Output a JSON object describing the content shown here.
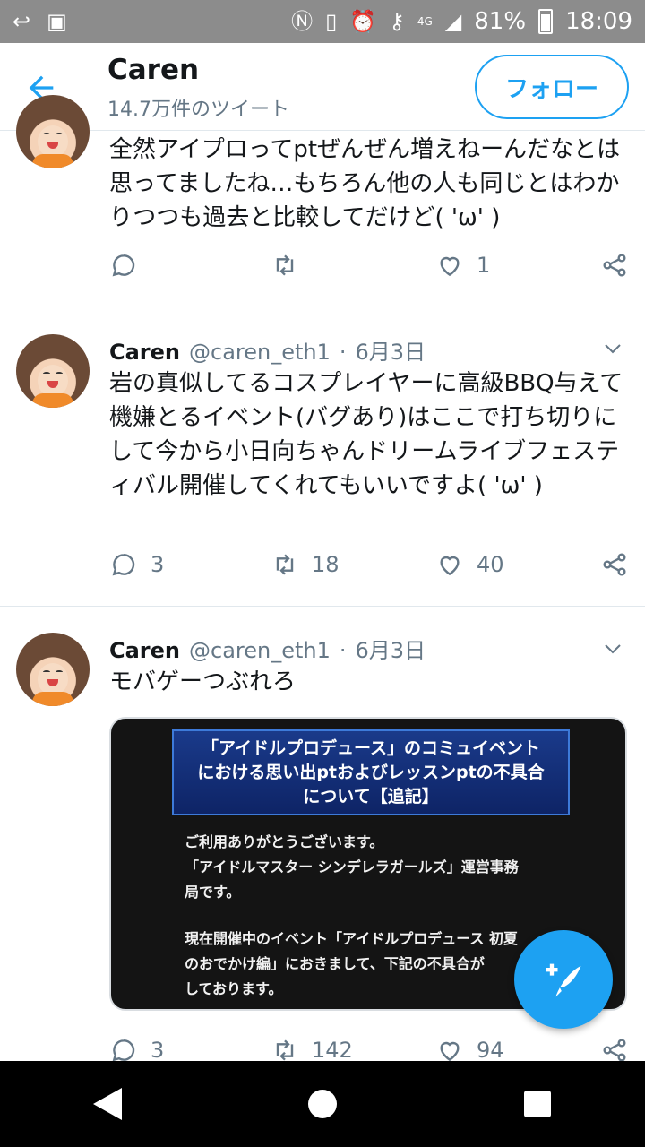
{
  "status_bar": {
    "network": "4G",
    "battery": "81%",
    "time": "18:09"
  },
  "header": {
    "name": "Caren",
    "tweet_count": "14.7万件のツイート",
    "follow_label": "フォロー"
  },
  "tweets": [
    {
      "text": "全然アイプロってptぜんぜん増えねーんだなとは思ってましたね…もちろん他の人も同じとはわかりつつも過去と比較してだけど( 'ω' )",
      "replies": "",
      "retweets": "",
      "likes": "1"
    },
    {
      "name": "Caren",
      "handle": "@caren_eth1",
      "dot": "·",
      "date": "6月3日",
      "text": "岩の真似してるコスプレイヤーに高級BBQ与えて機嫌とるイベント(バグあり)はここで打ち切りにして今から小日向ちゃんドリームライブフェスティバル開催してくれてもいいですよ( 'ω' )",
      "replies": "3",
      "retweets": "18",
      "likes": "40"
    },
    {
      "name": "Caren",
      "handle": "@caren_eth1",
      "dot": "·",
      "date": "6月3日",
      "text": "モバゲーつぶれろ",
      "replies": "3",
      "retweets": "142",
      "likes": "94",
      "card": {
        "title_line1": "「アイドルプロデュース」のコミュイベント",
        "title_line2": "における思い出ptおよびレッスンptの不具合",
        "title_line3": "について【追記】",
        "body_line1": "ご利用ありがとうございます。",
        "body_line2": "「アイドルマスター シンデレラガールズ」運営事務",
        "body_line3": "局です。",
        "body_line4": "現在開催中のイベント「アイドルプロデュース 初夏",
        "body_line5": "のおでかけ編」におきまして、下記の不具合が",
        "body_line6": "しております。"
      }
    }
  ],
  "icons": {
    "reply": "reply-icon",
    "retweet": "retweet-icon",
    "like": "heart-icon",
    "share": "share-icon",
    "compose": "compose-tweet-icon"
  },
  "colors": {
    "accent": "#1da1f2",
    "secondary_text": "#657786",
    "divider": "#e1e8ed"
  }
}
